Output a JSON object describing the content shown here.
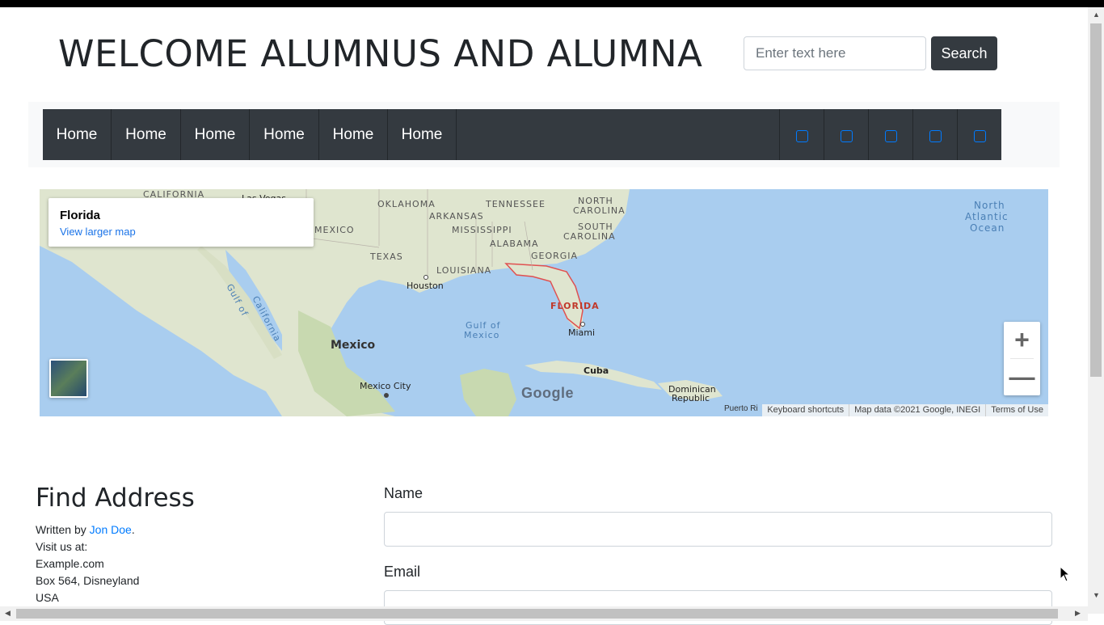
{
  "header": {
    "title": "WELCOME ALUMNUS AND ALUMNA",
    "search_placeholder": "Enter text here",
    "search_button": "Search"
  },
  "nav": {
    "items": [
      "Home",
      "Home",
      "Home",
      "Home",
      "Home",
      "Home"
    ],
    "icon_count": 5,
    "accent_color": "#007bff",
    "bar_color": "#343a40"
  },
  "map": {
    "place_name": "Florida",
    "larger_map_link": "View larger map",
    "footer": {
      "shortcuts": "Keyboard shortcuts",
      "data": "Map data ©2021 Google, INEGI",
      "terms": "Terms of Use"
    },
    "logo": "Google",
    "labels": {
      "california": "CALIFORNIA",
      "las_vegas": "Las Vegas",
      "oklahoma": "OKLAHOMA",
      "tennessee": "TENNESSEE",
      "north_carolina_1": "NORTH",
      "north_carolina_2": "CAROLINA",
      "arkansas": "ARKANSAS",
      "mississippi": "MISSISSIPPI",
      "south_carolina_1": "SOUTH",
      "south_carolina_2": "CAROLINA",
      "alabama": "ALABAMA",
      "georgia": "GEORGIA",
      "new_mexico": "MEXICO",
      "texas": "TEXAS",
      "louisiana": "LOUISIANA",
      "houston": "Houston",
      "florida": "FLORIDA",
      "miami": "Miami",
      "gulf_california_1": "Gulf of",
      "gulf_california_2": "California",
      "gulf_mexico_1": "Gulf of",
      "gulf_mexico_2": "Mexico",
      "mexico": "Mexico",
      "mexico_city": "Mexico City",
      "cuba": "Cuba",
      "dominican_1": "Dominican",
      "dominican_2": "Republic",
      "puerto_rico": "Puerto Ri",
      "ocean_1": "North",
      "ocean_2": "Atlantic",
      "ocean_3": "Ocean"
    }
  },
  "article": {
    "heading": "Find Address",
    "written_by": "Written by",
    "author": "Jon Doe",
    "period": ".",
    "visit": "Visit us at:",
    "site": "Example.com",
    "address": "Box 564, Disneyland",
    "country": "USA"
  },
  "form": {
    "name_label": "Name",
    "email_label": "Email"
  }
}
